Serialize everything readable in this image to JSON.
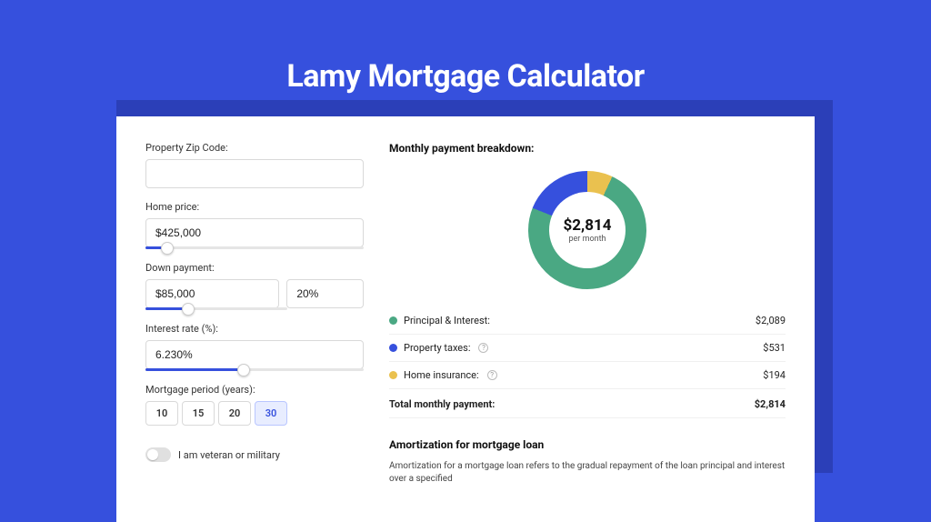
{
  "title": "Lamy Mortgage Calculator",
  "form": {
    "zip_label": "Property Zip Code:",
    "zip_value": "",
    "home_price_label": "Home price:",
    "home_price_value": "$425,000",
    "home_price_slider_pct": 10,
    "down_payment_label": "Down payment:",
    "down_payment_value": "$85,000",
    "down_payment_pct": "20%",
    "down_payment_slider_pct": 30,
    "interest_label": "Interest rate (%):",
    "interest_value": "6.230%",
    "interest_slider_pct": 45,
    "period_label": "Mortgage period (years):",
    "period_options": [
      "10",
      "15",
      "20",
      "30"
    ],
    "period_selected": "30",
    "veteran_label": "I am veteran or military"
  },
  "breakdown": {
    "heading": "Monthly payment breakdown:",
    "center_amount": "$2,814",
    "center_sub": "per month",
    "items": [
      {
        "label": "Principal & Interest:",
        "value": "$2,089",
        "color": "green",
        "info": false
      },
      {
        "label": "Property taxes:",
        "value": "$531",
        "color": "blue",
        "info": true
      },
      {
        "label": "Home insurance:",
        "value": "$194",
        "color": "yellow",
        "info": true
      }
    ],
    "total_label": "Total monthly payment:",
    "total_value": "$2,814"
  },
  "amortization": {
    "heading": "Amortization for mortgage loan",
    "text": "Amortization for a mortgage loan refers to the gradual repayment of the loan principal and interest over a specified"
  },
  "chart_data": {
    "type": "pie",
    "title": "Monthly payment breakdown",
    "series": [
      {
        "name": "Principal & Interest",
        "value": 2089,
        "color": "#4aa883"
      },
      {
        "name": "Property taxes",
        "value": 531,
        "color": "#3650dd"
      },
      {
        "name": "Home insurance",
        "value": 194,
        "color": "#eac14f"
      }
    ],
    "total": 2814,
    "center_label": "$2,814 per month"
  }
}
